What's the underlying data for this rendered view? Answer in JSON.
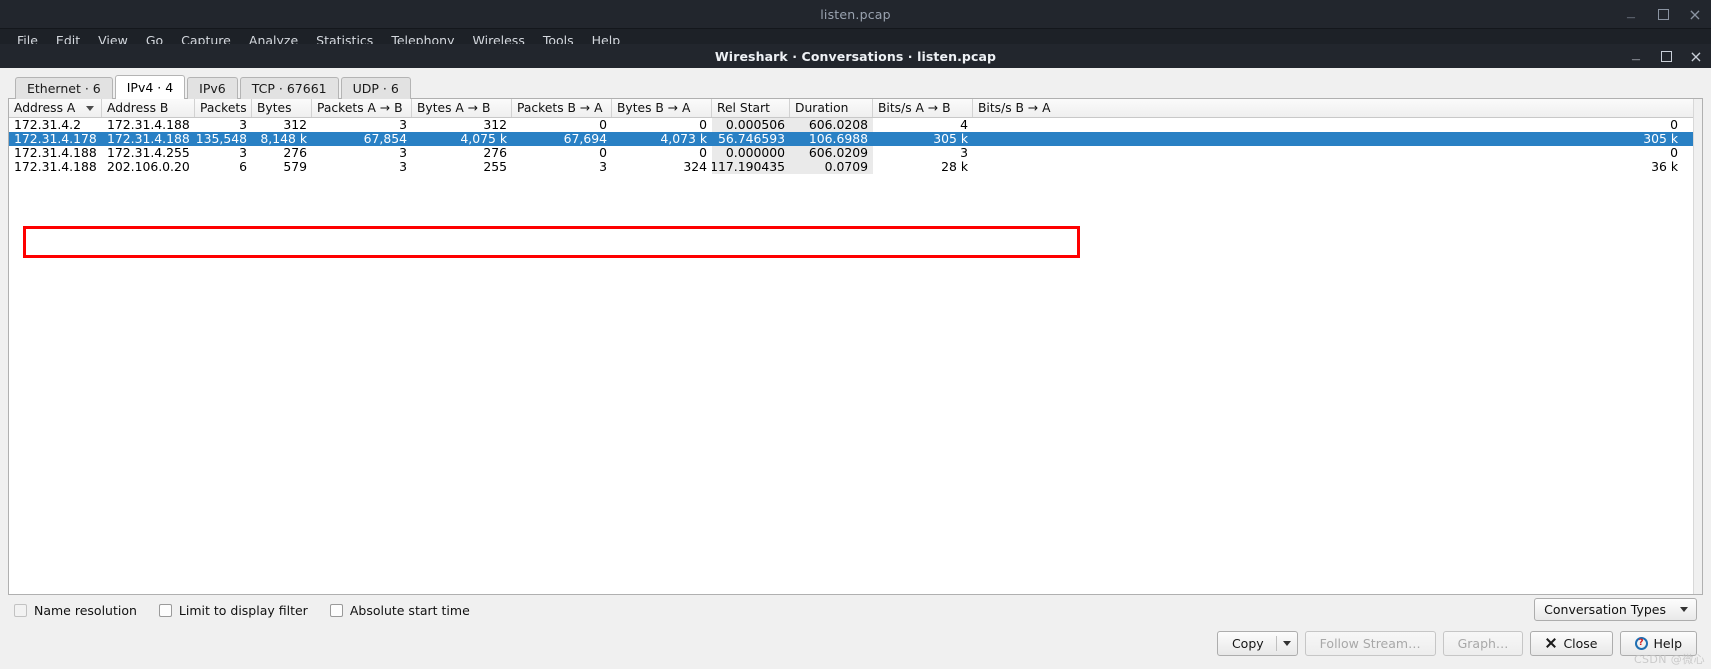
{
  "app": {
    "title": "listen.pcap",
    "window_buttons": [
      "minimize-icon",
      "maximize-icon",
      "close-icon"
    ],
    "menu": [
      {
        "label": "File",
        "mnemonic": "F"
      },
      {
        "label": "Edit",
        "mnemonic": "E"
      },
      {
        "label": "View",
        "mnemonic": "V"
      },
      {
        "label": "Go",
        "mnemonic": "G"
      },
      {
        "label": "Capture",
        "mnemonic": "C"
      },
      {
        "label": "Analyze",
        "mnemonic": "A"
      },
      {
        "label": "Statistics",
        "mnemonic": "S"
      },
      {
        "label": "Telephony",
        "mnemonic": "T"
      },
      {
        "label": "Wireless",
        "mnemonic": "W"
      },
      {
        "label": "Tools",
        "mnemonic": "T"
      },
      {
        "label": "Help",
        "mnemonic": "H"
      }
    ]
  },
  "dialog": {
    "title": "Wireshark · Conversations · listen.pcap",
    "window_buttons": [
      "minimize-icon",
      "maximize-icon",
      "close-icon"
    ],
    "tabs": [
      {
        "label": "Ethernet · 6",
        "active": false
      },
      {
        "label": "IPv4 · 4",
        "active": true
      },
      {
        "label": "IPv6",
        "active": false
      },
      {
        "label": "TCP · 67661",
        "active": false
      },
      {
        "label": "UDP · 6",
        "active": false
      }
    ],
    "table": {
      "columns": [
        "Address A",
        "Address B",
        "Packets",
        "Bytes",
        "Packets A → B",
        "Bytes A → B",
        "Packets B → A",
        "Bytes B → A",
        "Rel Start",
        "Duration",
        "Bits/s A → B",
        "Bits/s B → A"
      ],
      "sort_column": "Address A",
      "sort_direction": "descending",
      "rows": [
        {
          "selected": false,
          "cells": [
            "172.31.4.2",
            "172.31.4.188",
            "3",
            "312",
            "3",
            "312",
            "0",
            "0",
            "0.000506",
            "606.0208",
            "4",
            "0"
          ]
        },
        {
          "selected": true,
          "cells": [
            "172.31.4.178",
            "172.31.4.188",
            "135,548",
            "8,148 k",
            "67,854",
            "4,075 k",
            "67,694",
            "4,073 k",
            "56.746593",
            "106.6988",
            "305 k",
            "305 k"
          ]
        },
        {
          "selected": false,
          "cells": [
            "172.31.4.188",
            "172.31.4.255",
            "3",
            "276",
            "3",
            "276",
            "0",
            "0",
            "0.000000",
            "606.0209",
            "3",
            "0"
          ]
        },
        {
          "selected": false,
          "cells": [
            "172.31.4.188",
            "202.106.0.20",
            "6",
            "579",
            "3",
            "255",
            "3",
            "324",
            "117.190435",
            "0.0709",
            "28 k",
            "36 k"
          ]
        }
      ]
    },
    "options": {
      "name_resolution": {
        "label": "Name resolution",
        "checked": false,
        "enabled": false
      },
      "limit_to_display_filter": {
        "label": "Limit to display filter",
        "checked": false,
        "enabled": true
      },
      "absolute_start_time": {
        "label": "Absolute start time",
        "checked": false,
        "enabled": true
      },
      "conversation_types": {
        "label": "Conversation Types",
        "icon": "chevron-down-icon"
      }
    },
    "buttons": {
      "copy": {
        "label": "Copy",
        "enabled": true,
        "has_dropdown": true
      },
      "follow_stream": {
        "label": "Follow Stream…",
        "enabled": false
      },
      "graph": {
        "label": "Graph…",
        "enabled": false
      },
      "close": {
        "label": "Close",
        "enabled": true,
        "icon": "close-x-icon"
      },
      "help": {
        "label": "Help",
        "enabled": true,
        "icon": "help-circle-icon"
      }
    },
    "annotation": {
      "type": "red-highlight-rectangle",
      "color": "#fe0000"
    }
  },
  "watermark": {
    "text": "CSDN @微心"
  },
  "colors": {
    "selection_blue": "#2980c4",
    "dialog_bg": "#f0f0f0",
    "titlebar_dark": "#22262d",
    "annotation_red": "#fe0000"
  }
}
